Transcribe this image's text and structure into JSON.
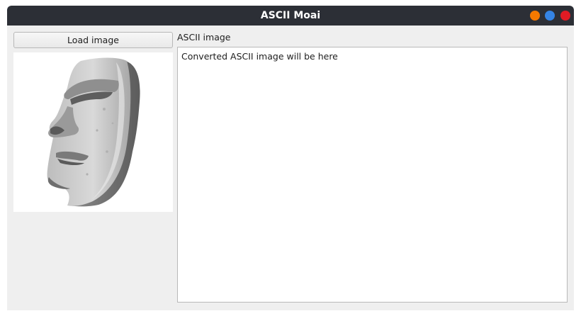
{
  "window": {
    "title": "ASCII Moai",
    "controls": {
      "minimize_color": "#f57900",
      "maximize_color": "#3584e4",
      "close_color": "#e01b24"
    }
  },
  "left_panel": {
    "load_button_label": "Load image",
    "preview_icon": "moai-icon"
  },
  "right_panel": {
    "label": "ASCII image",
    "output_placeholder": "Converted ASCII image will be here"
  },
  "colors": {
    "titlebar": "#2c2f36",
    "window_bg": "#efefef"
  }
}
